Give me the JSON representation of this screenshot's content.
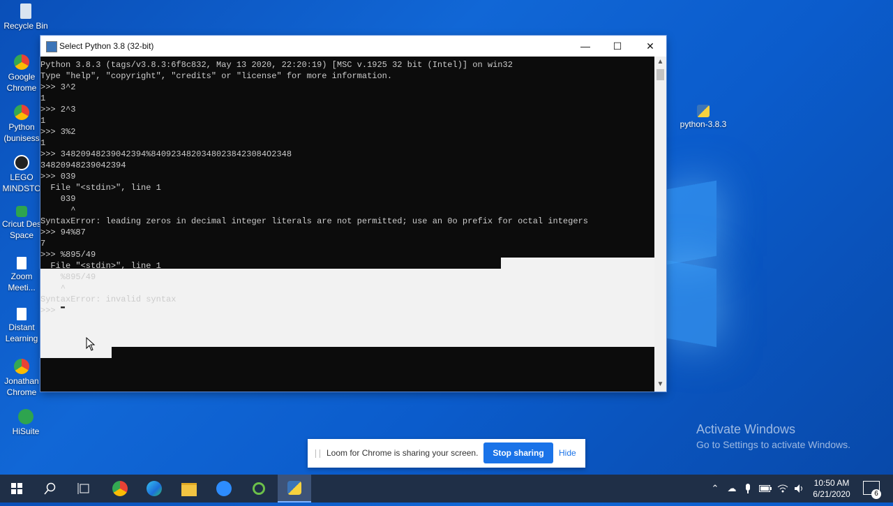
{
  "desktop": {
    "icons": [
      {
        "label": "Recycle Bin",
        "icon": "recycle-bin-icon",
        "color": "#d8e4f0"
      },
      {
        "label": "Google\nChrome",
        "icon": "chrome-icon",
        "color": "#e94235"
      },
      {
        "label": "Python\n(bunisess",
        "icon": "chrome-profile-icon",
        "color": "#e94235"
      },
      {
        "label": "LEGO\nMINDSTO",
        "icon": "lego-mindstorms-icon",
        "color": "#222222"
      },
      {
        "label": "Cricut Des\nSpace",
        "icon": "cricut-icon",
        "color": "#2ea44f"
      },
      {
        "label": "Zoom\nMeeti...",
        "icon": "zoom-shortcut-icon",
        "color": "#ffffff"
      },
      {
        "label": "Distant\nLearning",
        "icon": "document-shortcut-icon",
        "color": "#ffffff"
      },
      {
        "label": "Jonathan\nChrome",
        "icon": "chrome-profile-icon",
        "color": "#e94235"
      },
      {
        "label": "HiSuite",
        "icon": "hisuite-icon",
        "color": "#2ea44f"
      }
    ],
    "right_icon": {
      "label": "python-3.8.3",
      "icon": "python-installer-icon"
    }
  },
  "window": {
    "title": "Select Python 3.8 (32-bit)",
    "minimize": "—",
    "maximize": "☐",
    "close": "✕",
    "console_lines": [
      "Python 3.8.3 (tags/v3.8.3:6f8c832, May 13 2020, 22:20:19) [MSC v.1925 32 bit (Intel)] on win32",
      "Type \"help\", \"copyright\", \"credits\" or \"license\" for more information.",
      ">>> 3^2",
      "1",
      ">>> 2^3",
      "1",
      ">>> 3%2",
      "1",
      ">>> 34820948239042394%84092348203480238423084O2348",
      "34820948239042394",
      ">>> 039",
      "  File \"<stdin>\", line 1",
      "    039",
      "      ^",
      "SyntaxError: leading zeros in decimal integer literals are not permitted; use an 0o prefix for octal integers",
      ">>> 94%87",
      "7",
      ">>> %895/49",
      "  File \"<stdin>\", line 1"
    ],
    "highlighted_lines": [
      "    %895/49",
      "    ^",
      "SyntaxError: invalid syntax",
      ">>> "
    ],
    "cursor": "▬"
  },
  "loom": {
    "message": "Loom for Chrome is sharing your screen.",
    "stop": "Stop sharing",
    "hide": "Hide"
  },
  "watermark": {
    "line1": "Activate Windows",
    "line2": "Go to Settings to activate Windows."
  },
  "taskbar": {
    "time": "10:50 AM",
    "date": "6/21/2020",
    "notifications": "6"
  }
}
